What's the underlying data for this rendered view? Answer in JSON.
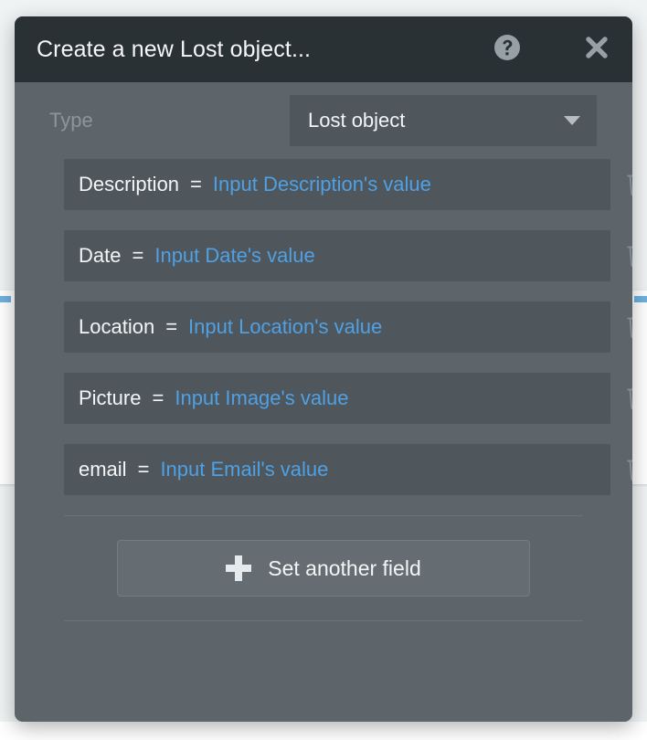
{
  "window": {
    "title": "Create a new Lost object...",
    "help_icon": "help-circle-icon",
    "close_icon": "close-icon"
  },
  "colors": {
    "titlebar_bg": "#2a3135",
    "modal_bg": "#5d656a",
    "row_bg": "#4f575c",
    "link_blue": "#4fa0e4",
    "accent_blue": "#6fb0df",
    "muted_text": "#8d969c",
    "text": "#f3f5f6"
  },
  "type_row": {
    "label": "Type",
    "selected": "Lost object",
    "caret_icon": "chevron-down-icon"
  },
  "fields": [
    {
      "name": "Description",
      "equals": "=",
      "value": "Input Description's value",
      "delete_icon": "trash-icon"
    },
    {
      "name": "Date",
      "equals": "=",
      "value": "Input Date's value",
      "delete_icon": "trash-icon"
    },
    {
      "name": "Location",
      "equals": "=",
      "value": "Input Location's value",
      "delete_icon": "trash-icon"
    },
    {
      "name": "Picture",
      "equals": "=",
      "value": "Input Image's value",
      "delete_icon": "trash-icon"
    },
    {
      "name": "email",
      "equals": "=",
      "value": "Input Email's value",
      "delete_icon": "trash-icon"
    }
  ],
  "add_field": {
    "label": "Set another field",
    "plus_icon": "plus-icon"
  }
}
